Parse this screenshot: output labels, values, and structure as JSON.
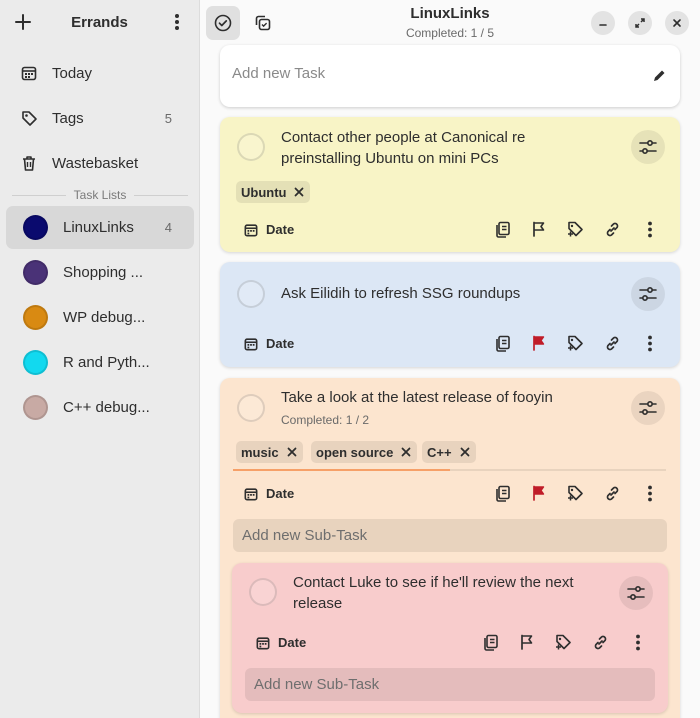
{
  "app": {
    "title": "Errands",
    "sidebar": {
      "today_label": "Today",
      "tags_label": "Tags",
      "tags_count": "5",
      "wastebasket_label": "Wastebasket",
      "section_label": "Task Lists",
      "lists": [
        {
          "name": "LinuxLinks",
          "count": "4",
          "color": "#0a0a6e"
        },
        {
          "name": "Shopping ...",
          "count": "",
          "color": "#4a3277"
        },
        {
          "name": "WP debug...",
          "count": "",
          "color": "#d98a12"
        },
        {
          "name": "R and Pyth...",
          "count": "",
          "color": "#12d9ef"
        },
        {
          "name": "C++ debug...",
          "count": "",
          "color": "#c8aaa4"
        }
      ]
    },
    "header": {
      "title": "LinuxLinks",
      "subtitle": "Completed: 1 / 5"
    },
    "add_task": {
      "placeholder": "Add new Task"
    },
    "tasks": [
      {
        "title_line1": "Contact other people at Canonical re",
        "title_line2": "preinstalling Ubuntu on mini PCs",
        "tags": [
          "Ubuntu"
        ],
        "date_label": "Date",
        "color": "#f8f4c6",
        "flagged": false
      },
      {
        "title_line1": "Ask Eilidih to refresh SSG roundups",
        "tags": [],
        "date_label": "Date",
        "color": "#dce7f5",
        "flagged": true
      },
      {
        "title_line1": "Take a look at the latest release of fooyin",
        "completed": "Completed: 1 / 2",
        "progress": 0.5,
        "tags": [
          "music",
          "open source",
          "C++"
        ],
        "date_label": "Date",
        "color": "#fce5cf",
        "flagged": true,
        "subtask_placeholder": "Add new Sub-Task",
        "subtasks": [
          {
            "title_line1": "Contact Luke to see if he'll review the next",
            "title_line2": "release",
            "date_label": "Date",
            "color": "#f8cccc",
            "flagged": false,
            "subtask_placeholder": "Add new Sub-Task"
          }
        ]
      }
    ],
    "colors": {
      "flag_red": "#c01c28",
      "progress": "#f6a068"
    }
  }
}
